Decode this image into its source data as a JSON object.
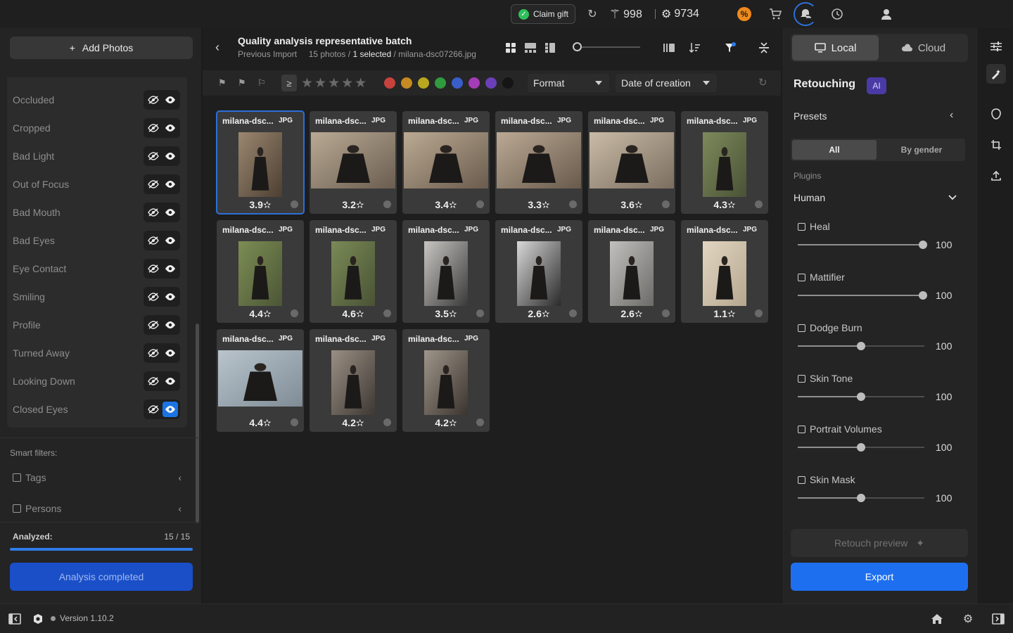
{
  "topbar": {
    "claim_gift": "Claim gift",
    "credits_wand": "998",
    "credits_ai": "9734",
    "icons": [
      "check-circle-icon",
      "refresh-icon",
      "magic-wand-icon",
      "ai-credits-icon",
      "promo-icon",
      "cart-icon",
      "notifications-icon",
      "history-icon",
      "user-icon"
    ]
  },
  "left": {
    "add_photos": "Add Photos",
    "filters": [
      {
        "label": "Occluded",
        "show_active": false
      },
      {
        "label": "Cropped",
        "show_active": false
      },
      {
        "label": "Bad Light",
        "show_active": false
      },
      {
        "label": "Out of Focus",
        "show_active": false
      },
      {
        "label": "Bad Mouth",
        "show_active": false
      },
      {
        "label": "Bad Eyes",
        "show_active": false
      },
      {
        "label": "Eye Contact",
        "show_active": false
      },
      {
        "label": "Smiling",
        "show_active": false
      },
      {
        "label": "Profile",
        "show_active": false
      },
      {
        "label": "Turned Away",
        "show_active": false
      },
      {
        "label": "Looking Down",
        "show_active": false
      },
      {
        "label": "Closed Eyes",
        "show_active": true
      }
    ],
    "smart_filters_title": "Smart filters:",
    "smart_filters": [
      "Tags",
      "Persons"
    ],
    "analyzed_label": "Analyzed:",
    "analyzed_value": "15 / 15",
    "analyzed_progress": 1.0,
    "analysis_button": "Analysis completed"
  },
  "header": {
    "title": "Quality analysis representative batch",
    "previous_import": "Previous Import",
    "photos_count": "15 photos /",
    "selected": "1 selected",
    "selected_file": "/ milana-dsc07266.jpg"
  },
  "filterbar": {
    "ge_symbol": "≥",
    "stars": "★★★★★",
    "color_labels": [
      "#c8423d",
      "#c58a21",
      "#b9a81e",
      "#2f9a3e",
      "#3a5ec8",
      "#a53cb7",
      "#6b3fb8",
      "#151515"
    ],
    "format_dropdown": "Format",
    "sort_dropdown": "Date of creation"
  },
  "photos": [
    {
      "name": "milana-dsc...",
      "format": "JPG",
      "score": "3.9",
      "selected": true,
      "orientation": "portrait"
    },
    {
      "name": "milana-dsc...",
      "format": "JPG",
      "score": "3.2",
      "selected": false,
      "orientation": "landscape"
    },
    {
      "name": "milana-dsc...",
      "format": "JPG",
      "score": "3.4",
      "selected": false,
      "orientation": "landscape"
    },
    {
      "name": "milana-dsc...",
      "format": "JPG",
      "score": "3.3",
      "selected": false,
      "orientation": "landscape"
    },
    {
      "name": "milana-dsc...",
      "format": "JPG",
      "score": "3.6",
      "selected": false,
      "orientation": "landscape"
    },
    {
      "name": "milana-dsc...",
      "format": "JPG",
      "score": "4.3",
      "selected": false,
      "orientation": "portrait"
    },
    {
      "name": "milana-dsc...",
      "format": "JPG",
      "score": "4.4",
      "selected": false,
      "orientation": "portrait"
    },
    {
      "name": "milana-dsc...",
      "format": "JPG",
      "score": "4.6",
      "selected": false,
      "orientation": "portrait"
    },
    {
      "name": "milana-dsc...",
      "format": "JPG",
      "score": "3.5",
      "selected": false,
      "orientation": "portrait"
    },
    {
      "name": "milana-dsc...",
      "format": "JPG",
      "score": "2.6",
      "selected": false,
      "orientation": "portrait"
    },
    {
      "name": "milana-dsc...",
      "format": "JPG",
      "score": "2.6",
      "selected": false,
      "orientation": "portrait"
    },
    {
      "name": "milana-dsc...",
      "format": "JPG",
      "score": "1.1",
      "selected": false,
      "orientation": "portrait"
    },
    {
      "name": "milana-dsc...",
      "format": "JPG",
      "score": "4.4",
      "selected": false,
      "orientation": "landscape"
    },
    {
      "name": "milana-dsc...",
      "format": "JPG",
      "score": "4.2",
      "selected": false,
      "orientation": "portrait"
    },
    {
      "name": "milana-dsc...",
      "format": "JPG",
      "score": "4.2",
      "selected": false,
      "orientation": "portrait"
    }
  ],
  "right": {
    "local": "Local",
    "cloud": "Cloud",
    "retouching": "Retouching",
    "ai_badge": "AI",
    "presets": "Presets",
    "seg_all": "All",
    "seg_gender": "By gender",
    "plugins": "Plugins",
    "human": "Human",
    "plugin_list": [
      {
        "label": "Heal",
        "value": "100",
        "level": 1.0
      },
      {
        "label": "Mattifier",
        "value": "100",
        "level": 1.0
      },
      {
        "label": "Dodge Burn",
        "value": "100",
        "level": 0.5
      },
      {
        "label": "Skin Tone",
        "value": "100",
        "level": 0.5
      },
      {
        "label": "Portrait Volumes",
        "value": "100",
        "level": 0.5
      },
      {
        "label": "Skin Mask",
        "value": "100",
        "level": 0.5
      }
    ],
    "retouch_preview": "Retouch preview",
    "export": "Export"
  },
  "footer": {
    "version": "Version 1.10.2"
  }
}
